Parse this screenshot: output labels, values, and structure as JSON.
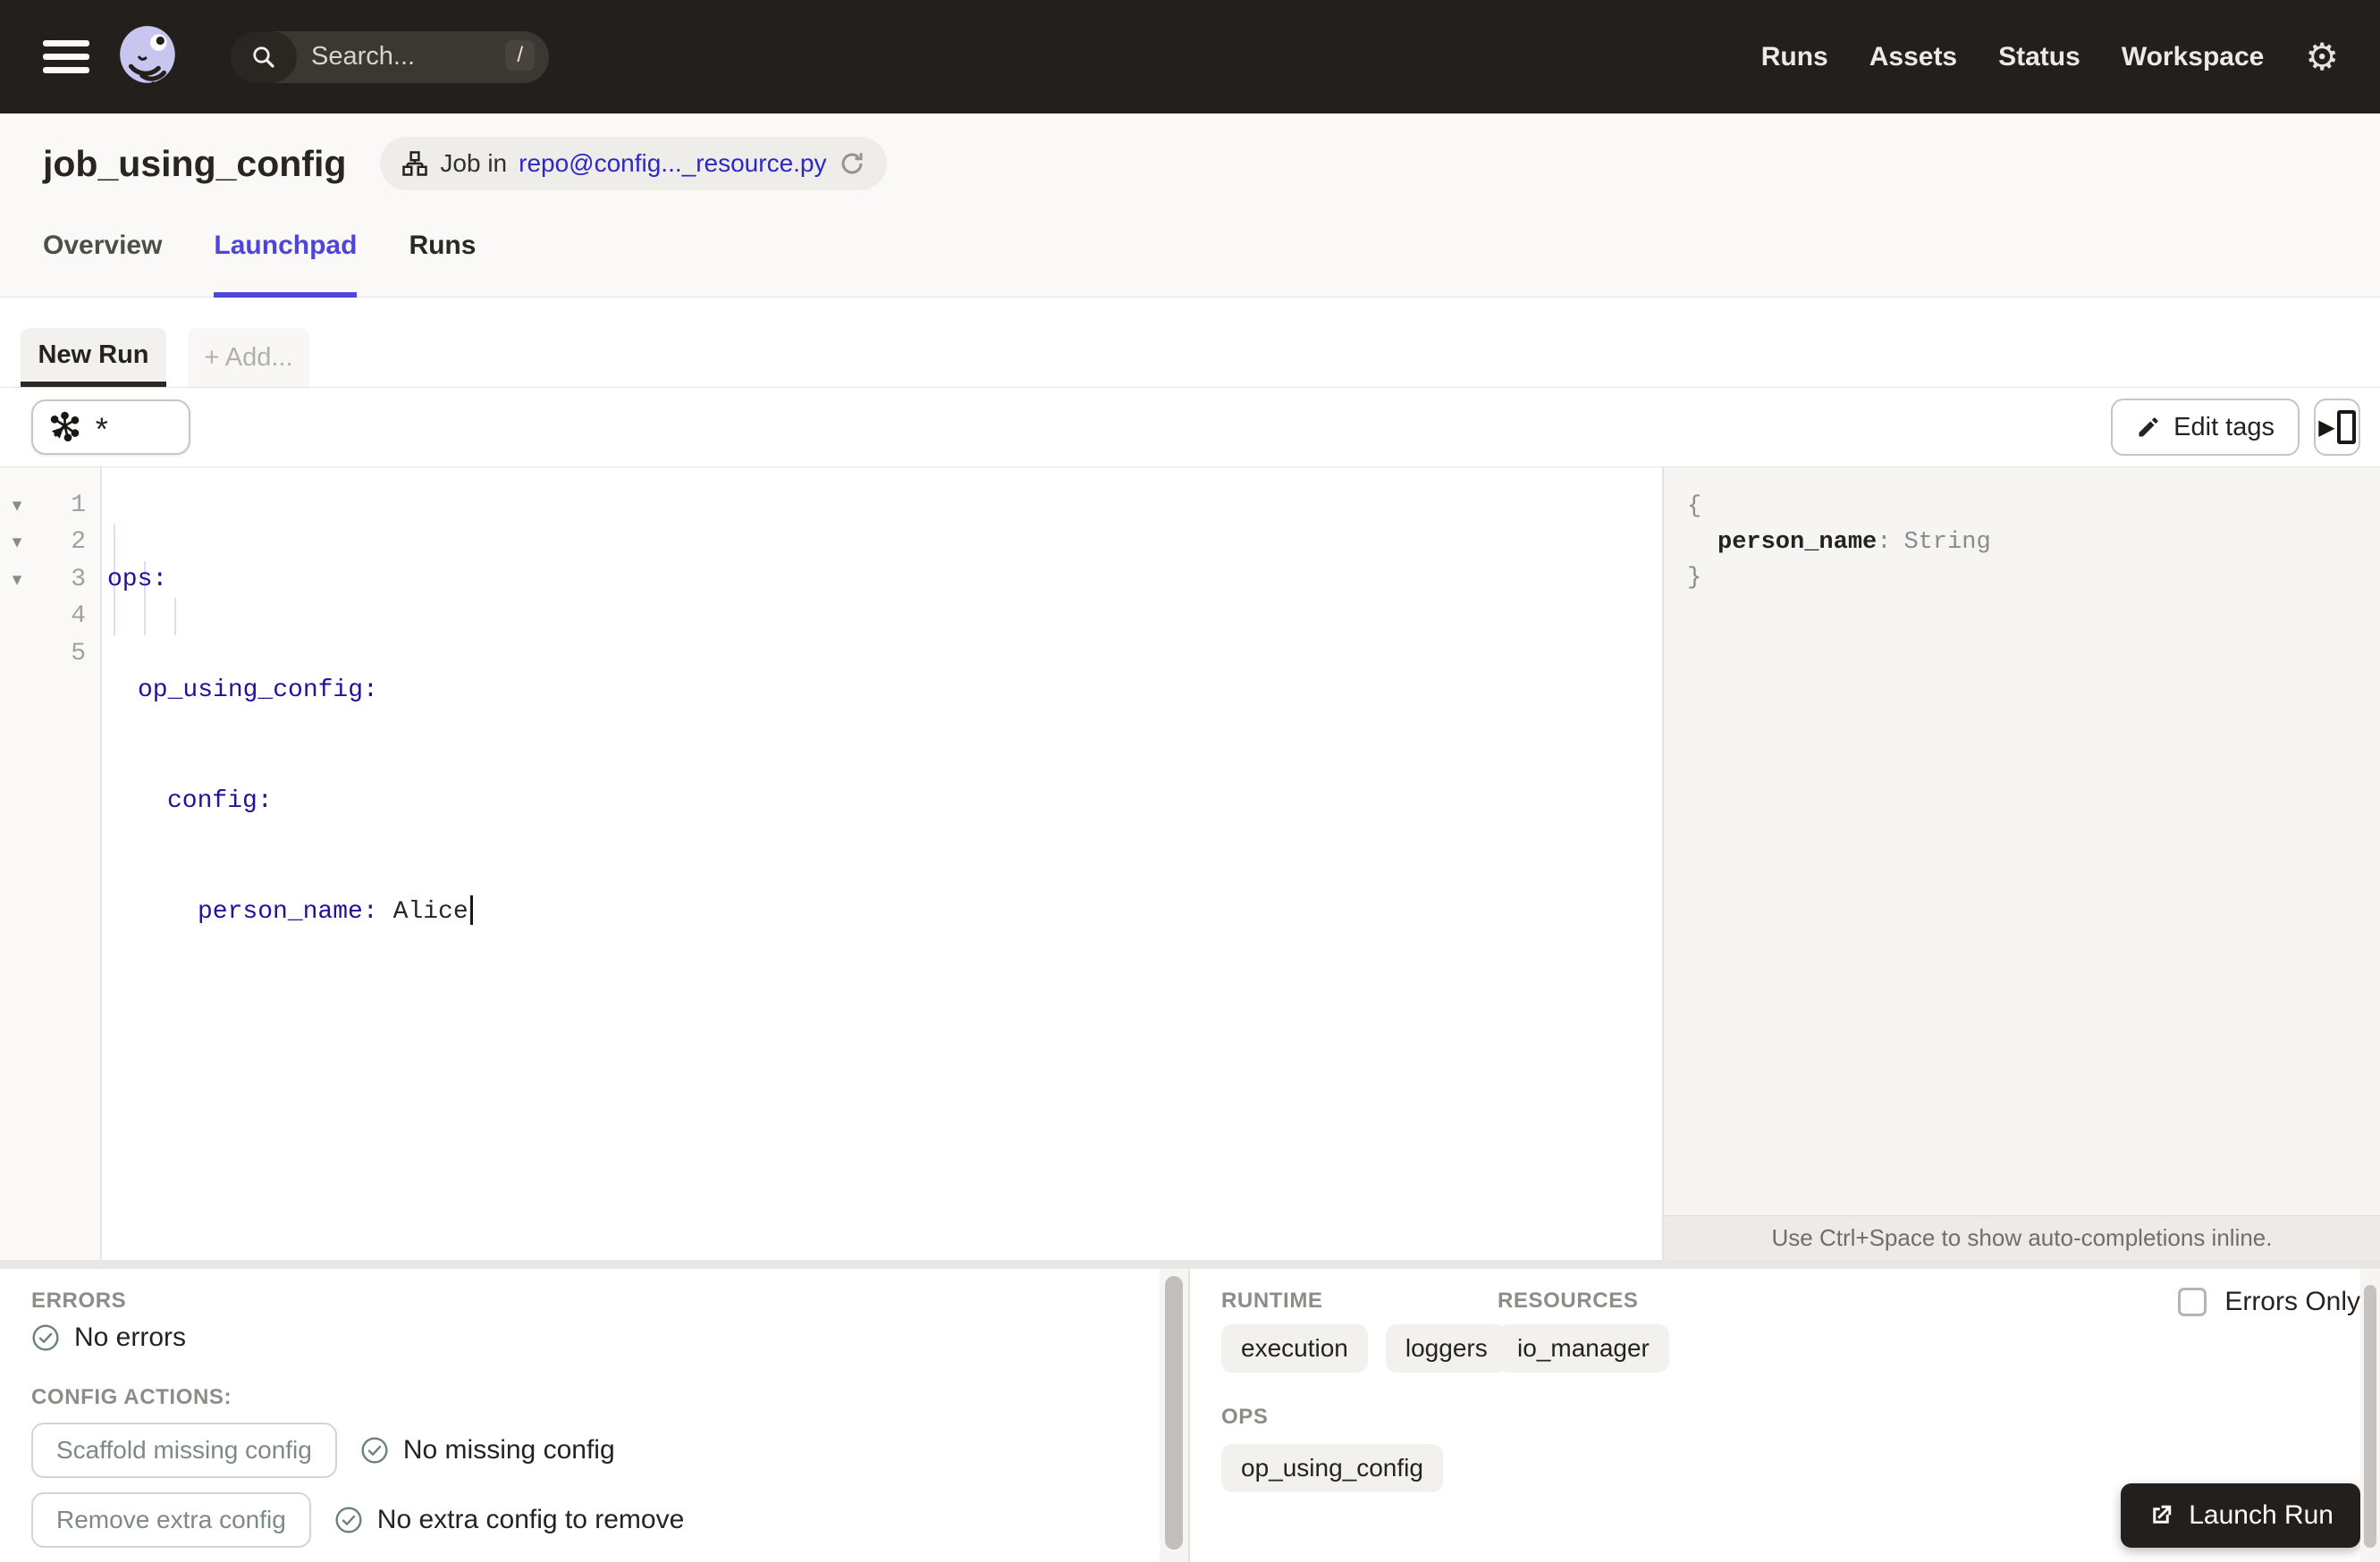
{
  "colors": {
    "nav_bg": "#231F1C",
    "accent_blurple": "#4E46DB",
    "link_blue": "#2D28C4",
    "yaml_key_blue": "#221199",
    "dark_button": "#231F1C"
  },
  "icons": {
    "gear": "⚙",
    "fold_arrow": "▾",
    "expand_play": "▶"
  },
  "nav": {
    "search_placeholder": "Search...",
    "search_shortcut": "/",
    "links": [
      "Runs",
      "Assets",
      "Status",
      "Workspace"
    ]
  },
  "header": {
    "title": "job_using_config",
    "badge_prefix": "Job in",
    "badge_link": "repo@config..._resource.py",
    "tabs": [
      "Overview",
      "Launchpad",
      "Runs"
    ]
  },
  "launchpad": {
    "new_run_tab": "New Run",
    "add_tab": "+ Add...",
    "op_selector": "*",
    "edit_tags": "Edit tags",
    "editor_lines": [
      {
        "num": "1",
        "key": "ops:"
      },
      {
        "num": "2",
        "key": "op_using_config:"
      },
      {
        "num": "3",
        "key": "config:"
      },
      {
        "num": "4",
        "key": "person_name:",
        "value": "Alice"
      },
      {
        "num": "5",
        "key": ""
      }
    ],
    "schema": {
      "open": "{",
      "key": "person_name",
      "sep": ":",
      "type": "String",
      "close": "}"
    },
    "hint": "Use Ctrl+Space to show auto-completions inline."
  },
  "bottom": {
    "errors_heading": "ERRORS",
    "errors_status": "No errors",
    "config_actions_heading": "CONFIG ACTIONS:",
    "actions": [
      {
        "button": "Scaffold missing config",
        "status": "No missing config"
      },
      {
        "button": "Remove extra config",
        "status": "No extra config to remove"
      }
    ],
    "runtime_heading": "RUNTIME",
    "runtime_tags": [
      "execution",
      "loggers"
    ],
    "resources_heading": "RESOURCES",
    "resources_tags": [
      "io_manager"
    ],
    "ops_heading": "OPS",
    "ops_tags": [
      "op_using_config"
    ],
    "errors_only_label": "Errors Only",
    "launch_label": "Launch Run"
  }
}
